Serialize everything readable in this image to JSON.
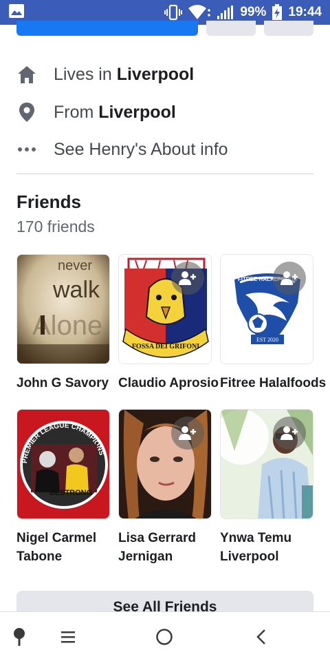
{
  "status_bar": {
    "battery": "99%",
    "time": "19:44",
    "icons": [
      "image-icon",
      "vibrate-icon",
      "wifi-icon",
      "signal-icon",
      "battery-charging-icon"
    ]
  },
  "intro": {
    "lives_prefix": "Lives in ",
    "lives_city": "Liverpool",
    "from_prefix": "From ",
    "from_city": "Liverpool",
    "about": "See Henry's About info",
    "icons": [
      "home-icon",
      "location-pin-icon",
      "more-dots-icon"
    ]
  },
  "friends": {
    "title": "Friends",
    "count": "170 friends",
    "items": [
      {
        "name": "John G Savory",
        "photo_text": [
          "never",
          "walk",
          "Alone"
        ]
      },
      {
        "name": "Claudio Aprosio",
        "photo_text": "FOSSA DEI GRIFONI"
      },
      {
        "name": "Fitree Halalfoods",
        "photo_text": [
          "FITREE HALALFOODS",
          "EST 2020"
        ]
      },
      {
        "name_line1": "Nigel Carmel",
        "name_line2": "Tabone",
        "photo_text": [
          "PREMIER LEAGUE CHAMPIONS",
          "BESTRONG"
        ]
      },
      {
        "name_line1": "Lisa Gerrard",
        "name_line2": "Jernigan"
      },
      {
        "name_line1": "Ynwa Temu",
        "name_line2": "Liverpool"
      }
    ],
    "see_all": "See All Friends"
  },
  "colors": {
    "status_bar": "#3b5cb8",
    "primary_button": "#1877f2",
    "secondary_button": "#e4e6eb",
    "text_primary": "#1c1e21",
    "text_secondary": "#606770"
  },
  "nav": {
    "icons": [
      "pin-icon",
      "menu-icon",
      "home-circle-icon",
      "back-icon"
    ]
  }
}
